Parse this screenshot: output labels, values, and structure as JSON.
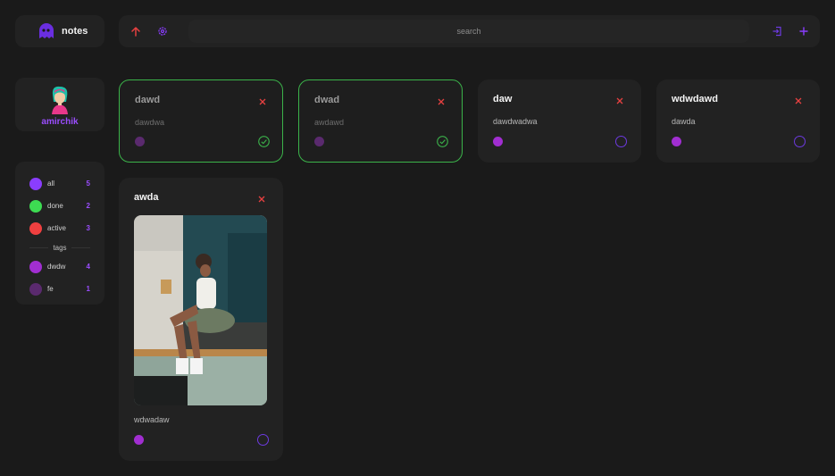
{
  "app": {
    "name": "notes"
  },
  "search": {
    "placeholder": "search"
  },
  "profile": {
    "username": "amirchik"
  },
  "filters": [
    {
      "label": "all",
      "count": "5",
      "color": "#8a3dff"
    },
    {
      "label": "done",
      "count": "2",
      "color": "#3ddc52"
    },
    {
      "label": "active",
      "count": "3",
      "color": "#f04040"
    }
  ],
  "tags_heading": "tags",
  "tags": [
    {
      "label": "dwdw",
      "count": "4",
      "color": "#a12ed1"
    },
    {
      "label": "fe",
      "count": "1",
      "color": "#5a2a6e"
    }
  ],
  "notes": [
    {
      "title": "dawd",
      "body": "dawdwa",
      "done": true
    },
    {
      "title": "dwad",
      "body": "awdawd",
      "done": true
    },
    {
      "title": "daw",
      "body": "dawdwadwa",
      "done": false
    },
    {
      "title": "wdwdawd",
      "body": "dawda",
      "done": false
    },
    {
      "title": "awda",
      "body": "wdwadaw",
      "done": false,
      "has_image": true
    }
  ],
  "colors": {
    "accent": "#9b4dff",
    "done_border": "#3bb34a",
    "close": "#e64040",
    "tag": "#a12ed1"
  }
}
